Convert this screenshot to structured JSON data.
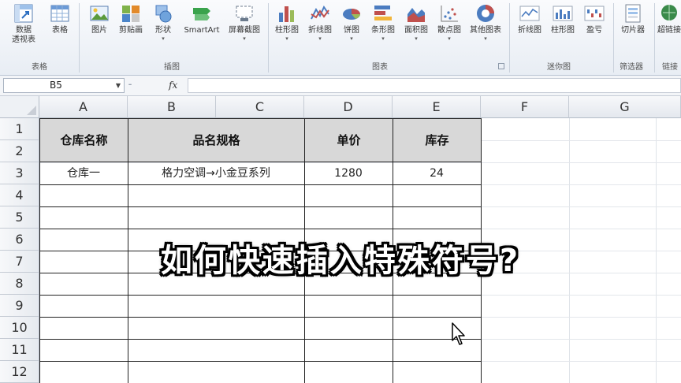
{
  "ribbon": {
    "buttons": [
      {
        "label": "数据",
        "label2": "透视表",
        "icon": "pivot-table-icon"
      },
      {
        "label": "表格",
        "icon": "table-icon"
      },
      {
        "label": "图片",
        "icon": "picture-icon"
      },
      {
        "label": "剪贴画",
        "icon": "clip-art-icon"
      },
      {
        "label": "形状",
        "icon": "shapes-icon"
      },
      {
        "label": "SmartArt",
        "icon": "smartart-icon"
      },
      {
        "label": "屏幕截图",
        "icon": "screenshot-icon"
      },
      {
        "label": "柱形图",
        "icon": "column-chart-icon"
      },
      {
        "label": "折线图",
        "icon": "line-chart-icon"
      },
      {
        "label": "饼图",
        "icon": "pie-chart-icon"
      },
      {
        "label": "条形图",
        "icon": "bar-chart-icon"
      },
      {
        "label": "面积图",
        "icon": "area-chart-icon"
      },
      {
        "label": "散点图",
        "icon": "scatter-chart-icon"
      },
      {
        "label": "其他图表",
        "icon": "other-charts-icon"
      },
      {
        "label": "折线图",
        "icon": "sparkline-line-icon"
      },
      {
        "label": "柱形图",
        "icon": "sparkline-column-icon"
      },
      {
        "label": "盈亏",
        "icon": "sparkline-winloss-icon"
      },
      {
        "label": "切片器",
        "icon": "slicer-icon"
      },
      {
        "label": "超链接",
        "icon": "hyperlink-icon"
      }
    ],
    "groups": [
      "表格",
      "插图",
      "图表",
      "迷你图",
      "筛选器",
      "链接"
    ]
  },
  "formula_bar": {
    "name_box": "B5",
    "fx_label": "fx",
    "formula": ""
  },
  "columns": [
    "A",
    "B",
    "C",
    "D",
    "E",
    "F",
    "G"
  ],
  "rows": [
    "1",
    "2",
    "3",
    "4",
    "5",
    "6",
    "7",
    "8",
    "9",
    "10",
    "11",
    "12"
  ],
  "table": {
    "headers": [
      "仓库名称",
      "品名规格",
      "单价",
      "库存"
    ],
    "row3": [
      "仓库一",
      "格力空调→小金豆系列",
      "1280",
      "24"
    ]
  },
  "overlay_title": "如何快速插入特殊符号?",
  "colors": {
    "header_fill": "#d8d8d8",
    "border": "#222222",
    "grid_line": "#dfe3e8"
  }
}
